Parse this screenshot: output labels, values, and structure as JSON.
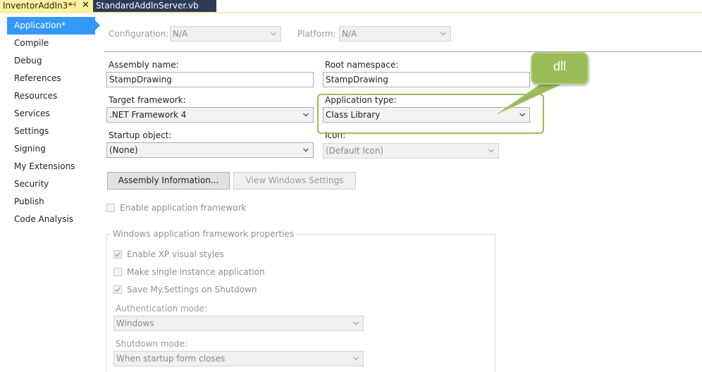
{
  "tabs": [
    {
      "label": "InventorAddIn3*",
      "pin": "⊣",
      "close": "✕"
    },
    {
      "label": "StandardAddInServer.vb"
    }
  ],
  "sidebar": {
    "items": [
      {
        "label": "Application*"
      },
      {
        "label": "Compile"
      },
      {
        "label": "Debug"
      },
      {
        "label": "References"
      },
      {
        "label": "Resources"
      },
      {
        "label": "Services"
      },
      {
        "label": "Settings"
      },
      {
        "label": "Signing"
      },
      {
        "label": "My Extensions"
      },
      {
        "label": "Security"
      },
      {
        "label": "Publish"
      },
      {
        "label": "Code Analysis"
      }
    ]
  },
  "config": {
    "configuration_label": "Configuration:",
    "configuration_value": "N/A",
    "platform_label": "Platform:",
    "platform_value": "N/A"
  },
  "form": {
    "assembly_name_label": "Assembly name:",
    "assembly_name_value": "StampDrawing",
    "root_namespace_label": "Root namespace:",
    "root_namespace_value": "StampDrawing",
    "target_framework_label": "Target framework:",
    "target_framework_value": ".NET Framework 4",
    "application_type_label": "Application type:",
    "application_type_value": "Class Library",
    "startup_object_label": "Startup object:",
    "startup_object_value": "(None)",
    "icon_label": "Icon:",
    "icon_value": "(Default Icon)",
    "assembly_info_button": "Assembly Information...",
    "view_windows_settings_button": "View Windows Settings",
    "enable_app_framework_label": "Enable application framework"
  },
  "framework_group": {
    "title": "Windows application framework properties",
    "enable_xp_label": "Enable XP visual styles",
    "single_instance_label": "Make single instance application",
    "save_settings_label": "Save My.Settings on Shutdown",
    "auth_mode_label": "Authentication mode:",
    "auth_mode_value": "Windows",
    "shutdown_mode_label": "Shutdown mode:",
    "shutdown_mode_value": "When startup form closes"
  },
  "callout": {
    "text": "dll",
    "color": "#9bbb59"
  },
  "colors": {
    "accent": "#3399ff",
    "active_tab": "#fff29d",
    "inactive_tab": "#2d3b5a"
  }
}
